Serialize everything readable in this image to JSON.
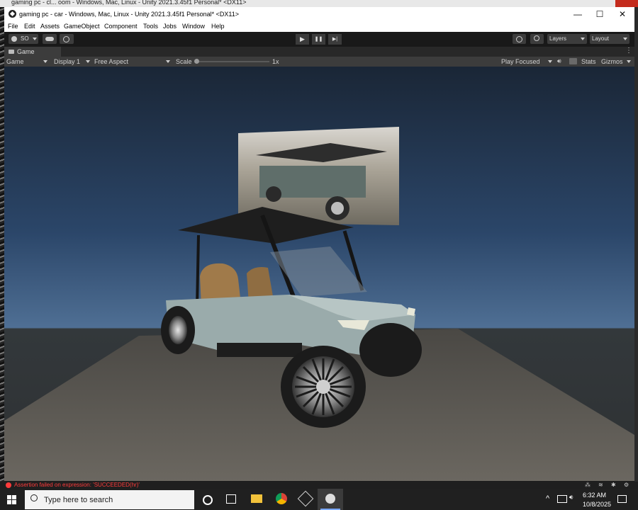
{
  "background_window": {
    "title": "gaming pc - cl... oom - Windows, Mac, Linux - Unity 2021.3.45f1 Personal* <DX11>"
  },
  "window": {
    "title": "gaming pc - car - Windows, Mac, Linux - Unity 2021.3.45f1 Personal* <DX11>",
    "minimize": "—",
    "maximize": "☐",
    "close": "✕"
  },
  "menu": [
    "File",
    "Edit",
    "Assets",
    "GameObject",
    "Component",
    "Tools",
    "Jobs",
    "Window",
    "Help"
  ],
  "toolbar": {
    "account": "SO",
    "play": "▶",
    "pause": "❚❚",
    "step": "▶|",
    "layers": "Layers",
    "layout": "Layout"
  },
  "tab": {
    "label": "Game"
  },
  "game_controls": {
    "mode": "Game",
    "display": "Display 1",
    "aspect": "Free Aspect",
    "scale_label": "Scale",
    "scale_value": "1x",
    "play_focused": "Play Focused",
    "stats": "Stats",
    "gizmos": "Gizmos"
  },
  "status": {
    "message": "Assertion failed on expression: 'SUCCEEDED(hr)'"
  },
  "taskbar": {
    "search_placeholder": "Type here to search",
    "time": "6:32 AM",
    "date": "10/8/2025"
  },
  "colors": {
    "accent_error": "#ff3b3b",
    "close_red": "#c42b1c"
  }
}
